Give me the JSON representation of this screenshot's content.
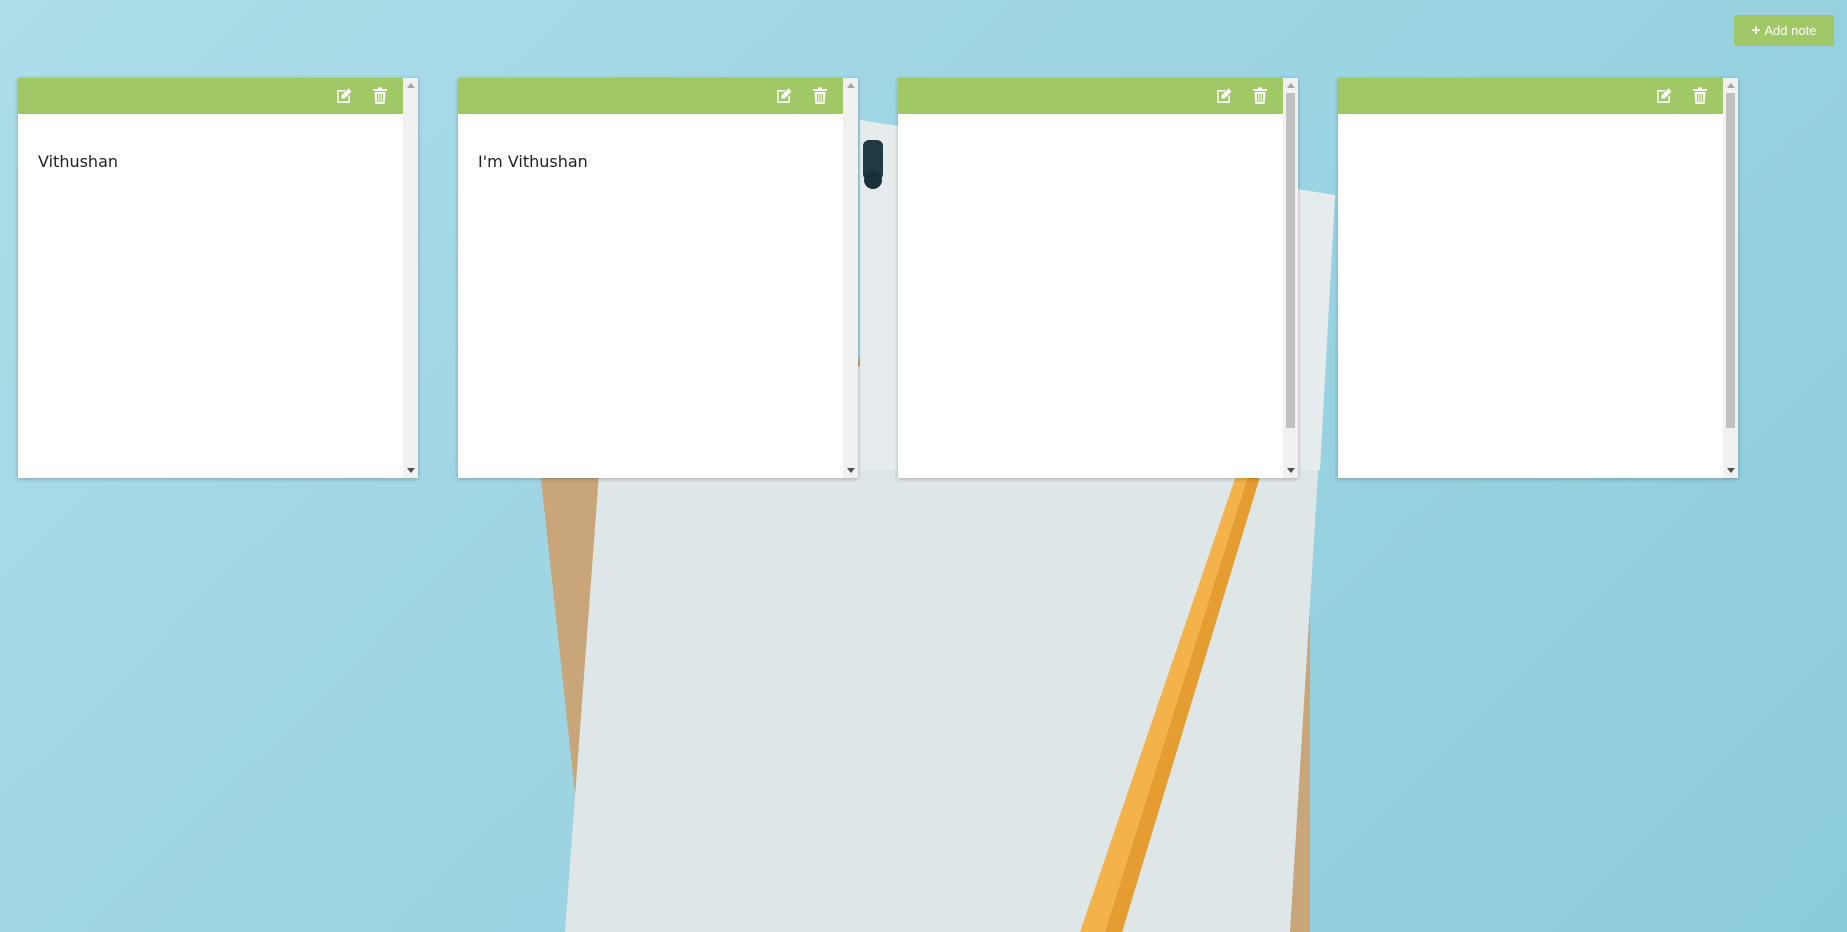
{
  "toolbar": {
    "add_note_label": "Add note"
  },
  "notes": [
    {
      "text": "Vithushan"
    },
    {
      "text": "I'm Vithushan"
    },
    {
      "text": ""
    },
    {
      "text": ""
    }
  ],
  "colors": {
    "accent": "#a0c866",
    "background": "#9fd6e3",
    "note": "#ffffff"
  },
  "icons": {
    "add": "plus-icon",
    "edit": "edit-icon",
    "delete": "trash-icon"
  }
}
